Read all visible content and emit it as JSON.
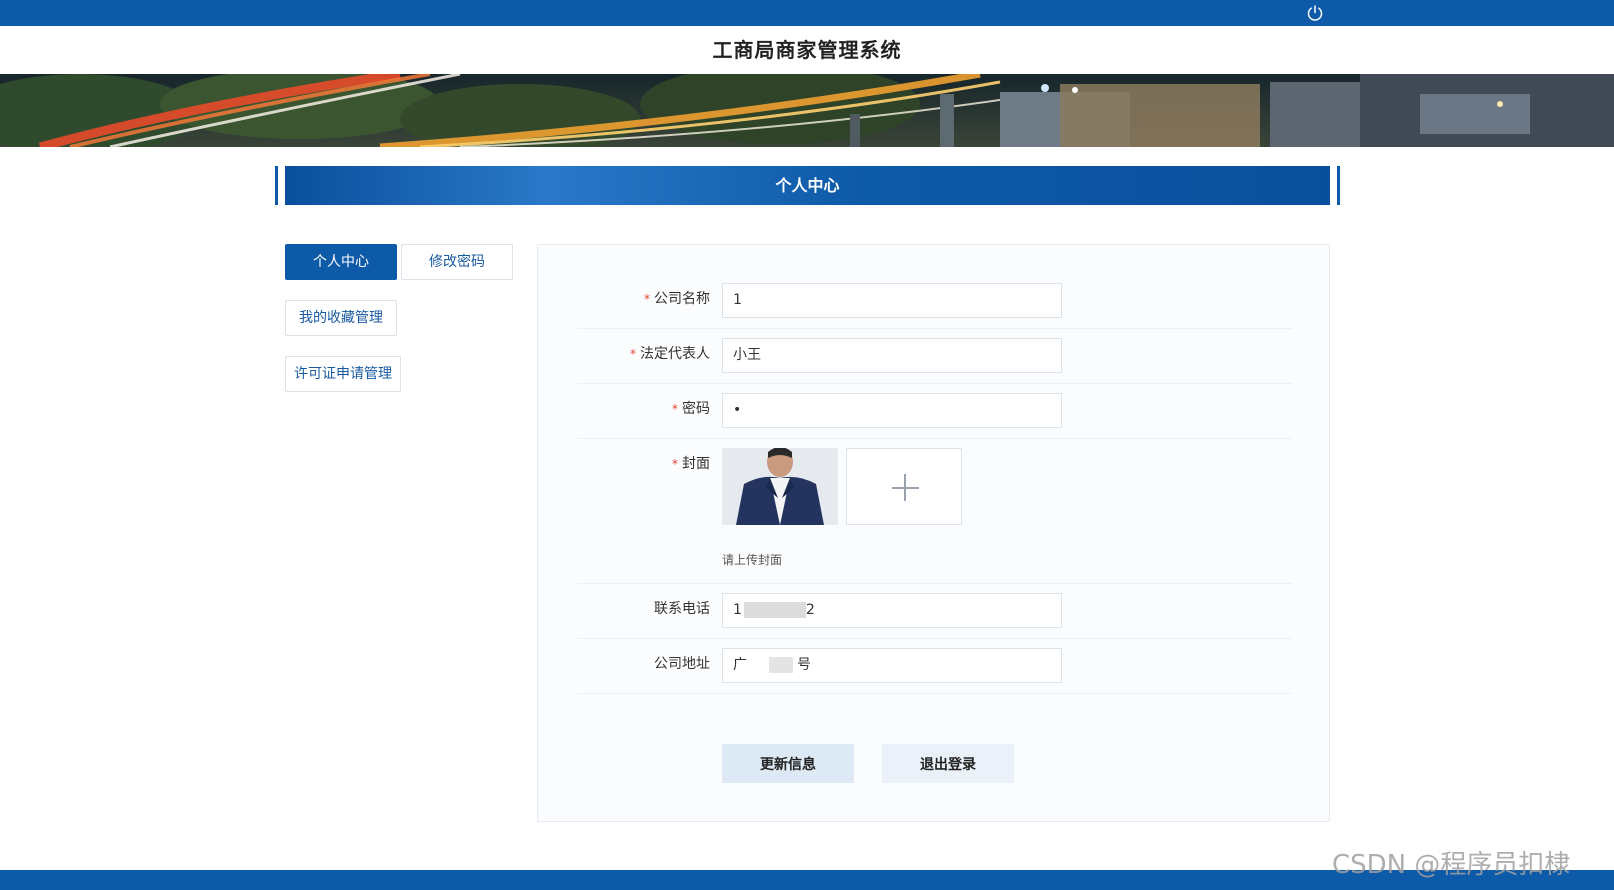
{
  "header": {
    "system_title": "工商局商家管理系统",
    "power_icon": "power-icon"
  },
  "section": {
    "title": "个人中心"
  },
  "tabs": [
    {
      "label": "个人中心",
      "active": true
    },
    {
      "label": "修改密码",
      "active": false
    },
    {
      "label": "我的收藏管理",
      "active": false
    },
    {
      "label": "许可证申请管理",
      "active": false
    }
  ],
  "form": {
    "required_mark": "*",
    "company_name": {
      "label": "公司名称",
      "value": "1"
    },
    "legal_rep": {
      "label": "法定代表人",
      "value": "小王"
    },
    "password": {
      "label": "密码",
      "value": "•"
    },
    "cover": {
      "label": "封面",
      "hint": "请上传封面"
    },
    "phone": {
      "label": "联系电话",
      "value_start": "1",
      "value_end": "2"
    },
    "address": {
      "label": "公司地址",
      "value_start": "广",
      "value_end": "号"
    }
  },
  "buttons": {
    "update": "更新信息",
    "logout": "退出登录"
  },
  "watermark": "CSDN @程序员扣棣",
  "colors": {
    "primary": "#0d5aa8",
    "required": "#e2452f",
    "update_btn_bg": "#dde9f5",
    "logout_btn_bg": "#eaf1f8"
  }
}
